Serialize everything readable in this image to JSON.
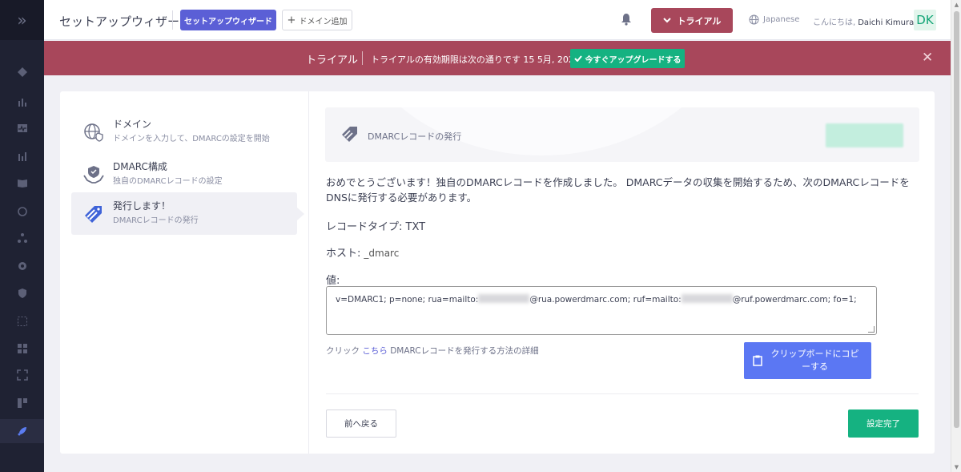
{
  "header": {
    "title": "セットアップウィザード",
    "wizard_button": "セットアップウィザード",
    "add_domain_button": "ドメイン追加",
    "trial_button": "トライアル",
    "language": "Japanese",
    "greeting": "こんにちは,",
    "user_name": "Daichi Kimura",
    "avatar_initials": "DK"
  },
  "banner": {
    "label": "トライアル",
    "message": "トライアルの有効期限は次の通りです 15 5月, 2022",
    "upgrade_button": "今すぐアップグレードする",
    "close": "✕"
  },
  "steps": [
    {
      "title": "ドメイン",
      "subtitle": "ドメインを入力して、DMARCの設定を開始"
    },
    {
      "title": "DMARC構成",
      "subtitle": "独自のDMARCレコードの設定"
    },
    {
      "title": "発行します！",
      "subtitle": "DMARCレコードの発行"
    }
  ],
  "content": {
    "section_title": "DMARCレコードの発行",
    "intro": "おめでとうございます！独自のDMARCレコードを作成しました。 DMARCデータの収集を開始するため、次のDMARCレコードをDNSに発行する必要があります。",
    "record_type_label": "レコードタイプ:",
    "record_type_value": "TXT",
    "host_label": "ホスト:",
    "host_value": "_dmarc",
    "value_label": "値:",
    "value_prefix": "v=DMARC1; p=none; rua=mailto:",
    "value_mid": "@rua.powerdmarc.com; ruf=mailto:",
    "value_suffix": "@ruf.powerdmarc.com; fo=1;",
    "hint_prefix": "クリック",
    "hint_link": "こちら",
    "hint_suffix": "DMARCレコードを発行する方法の詳細",
    "copy_button": "クリップボードにコピーする",
    "back_button": "前へ戻る",
    "done_button": "設定完了"
  },
  "colors": {
    "primary": "#5b5fd6",
    "trial": "#a8475b",
    "success": "#15b281",
    "copy": "#5b77f3",
    "sidebar": "#1f2233"
  }
}
